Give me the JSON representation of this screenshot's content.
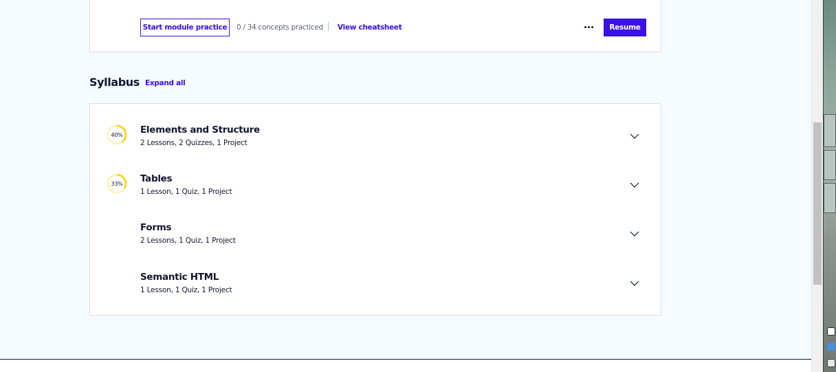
{
  "module": {
    "start_practice_label": "Start module practice",
    "concepts_text": "0 / 34 concepts practiced",
    "cheatsheet_label": "View cheatsheet",
    "more_label": "More options",
    "resume_label": "Resume"
  },
  "syllabus": {
    "title": "Syllabus",
    "expand_all_label": "Expand all",
    "items": [
      {
        "title": "Elements and Structure",
        "summary": "2 Lessons, 2 Quizzes, 1 Project",
        "progress_label": "40%",
        "progress": 0.4
      },
      {
        "title": "Tables",
        "summary": "1 Lesson, 1 Quiz, 1 Project",
        "progress_label": "33%",
        "progress": 0.33
      },
      {
        "title": "Forms",
        "summary": "2 Lessons, 1 Quiz, 1 Project",
        "progress_label": "",
        "progress": null
      },
      {
        "title": "Semantic HTML",
        "summary": "1 Lesson, 1 Quiz, 1 Project",
        "progress_label": "",
        "progress": null
      }
    ]
  },
  "colors": {
    "accent": "#3a10e5",
    "progress": "#ffd300",
    "progress_track": "#fff3b0",
    "background": "#f5fbff"
  },
  "icons": [
    "more-icon",
    "chevron-down-icon",
    "progress-ring-icon"
  ]
}
